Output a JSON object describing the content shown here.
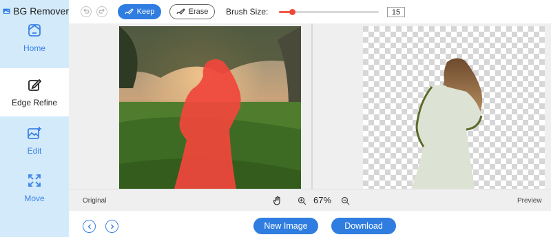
{
  "app": {
    "title": "BG Remover"
  },
  "sidebar": {
    "items": [
      {
        "label": "Home",
        "icon": "home-icon"
      },
      {
        "label": "Edge Refine",
        "icon": "edge-refine-icon",
        "active": true
      },
      {
        "label": "Edit",
        "icon": "edit-image-icon"
      },
      {
        "label": "Move",
        "icon": "move-arrows-icon"
      }
    ]
  },
  "toolbar": {
    "undo_icon": "undo-icon",
    "redo_icon": "redo-icon",
    "keep_label": "Keep",
    "erase_label": "Erase",
    "brush_size_label": "Brush Size:",
    "brush_size_value": "15",
    "brush_size_fraction": 0.13
  },
  "canvas": {
    "left_panel": "original photo with red keep mask over woman",
    "right_panel": "preview with transparent checkerboard background"
  },
  "bottom_bar": {
    "original_label": "Original",
    "preview_label": "Preview",
    "zoom_value": "67%",
    "hand_icon": "hand-pan-icon",
    "zoom_in_icon": "zoom-in-icon",
    "zoom_out_icon": "zoom-out-icon"
  },
  "footer": {
    "new_image_label": "New Image",
    "download_label": "Download"
  },
  "colors": {
    "accent": "#2f7de1",
    "sidebar_bg": "#d3eafb",
    "mask_red": "#f0473b"
  }
}
